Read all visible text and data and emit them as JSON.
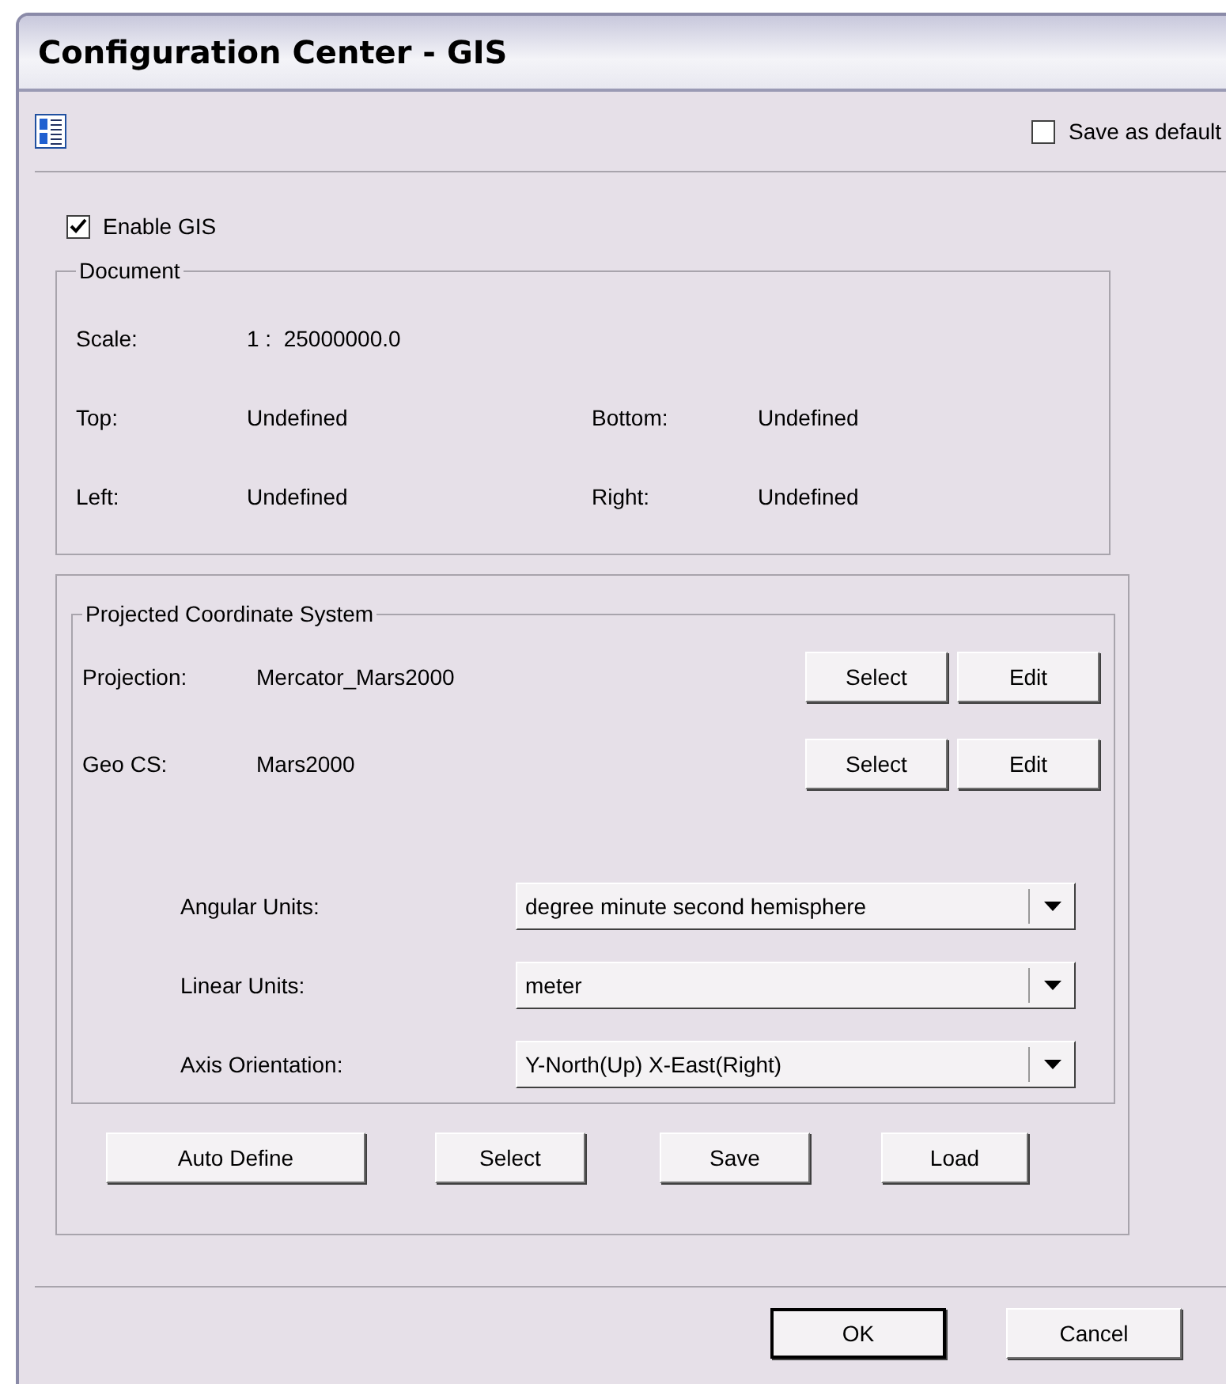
{
  "window": {
    "title": "Configuration Center - GIS"
  },
  "toolbar": {
    "save_as_default": {
      "label": "Save as default",
      "checked": false
    }
  },
  "enable_gis": {
    "label": "Enable GIS",
    "checked": true
  },
  "document": {
    "title": "Document",
    "scale_label": "Scale:",
    "scale_value": "1 :  25000000.0",
    "rows": [
      {
        "label": "Top:",
        "value": "Undefined",
        "label_2": "Bottom:",
        "value_2": "Undefined"
      },
      {
        "label": "Left:",
        "value": "Undefined",
        "label_2": "Right:",
        "value_2": "Undefined"
      }
    ]
  },
  "projected_cs": {
    "title": "Projected Coordinate System",
    "rows": [
      {
        "label": "Projection:",
        "value": "Mercator_Mars2000",
        "buttons": [
          "Select",
          "Edit"
        ]
      },
      {
        "label": "Geo CS:",
        "value": "Mars2000",
        "buttons": [
          "Select",
          "Edit"
        ]
      }
    ],
    "dropdowns": [
      {
        "label": "Angular Units:",
        "value": "degree minute second hemisphere"
      },
      {
        "label": "Linear Units:",
        "value": "meter"
      },
      {
        "label": "Axis Orientation:",
        "value": "Y-North(Up) X-East(Right)"
      }
    ]
  },
  "actions": [
    "Auto Define",
    "Select",
    "Save",
    "Load"
  ],
  "buttons": [
    "OK",
    "Cancel"
  ]
}
